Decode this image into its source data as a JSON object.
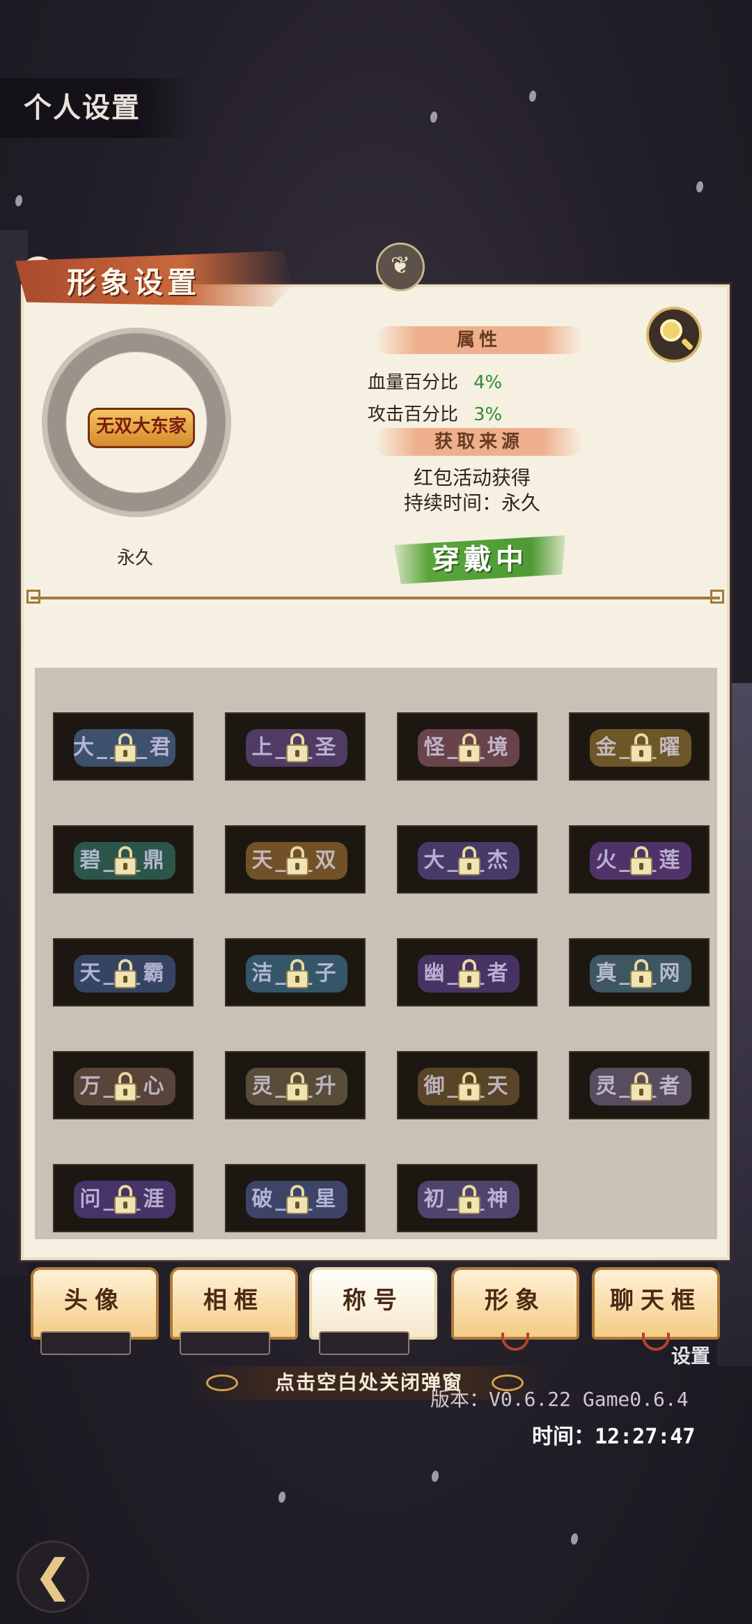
{
  "page": {
    "title": "个人设置",
    "settings_label": "设置",
    "close_hint": "点击空白处关闭弹窗",
    "version": "版本：V0.6.22 Game0.6.4",
    "time": "时间：12:27:47",
    "back_icon": "back-arrow-icon"
  },
  "panel": {
    "title": "形象设置",
    "equipped_badge": "无双大东家",
    "duration_under_avatar": "永久",
    "attributes_header": "属性",
    "attributes": [
      {
        "label": "血量百分比",
        "value": "4%"
      },
      {
        "label": "攻击百分比",
        "value": "3%"
      }
    ],
    "source_header": "获取来源",
    "source_text": "红包活动获得",
    "duration_text": "持续时间：永久",
    "wearing_label": "穿戴中",
    "colors": {
      "panel_bg": "#f6f0e2",
      "value_green": "#2e8d2e",
      "wearing_green": "#4e9a34"
    }
  },
  "titles": [
    {
      "name": "大____君",
      "color": "#5a7fb8",
      "locked": true
    },
    {
      "name": "上___圣",
      "color": "#7a5aa8",
      "locked": true
    },
    {
      "name": "怪___境",
      "color": "#a86a7a",
      "locked": true
    },
    {
      "name": "金___曜",
      "color": "#b08a3a",
      "locked": true
    },
    {
      "name": "碧___鼎",
      "color": "#3a8a7a",
      "locked": true
    },
    {
      "name": "天___双",
      "color": "#b8823a",
      "locked": true
    },
    {
      "name": "大___杰",
      "color": "#6a5ab0",
      "locked": true
    },
    {
      "name": "火___莲",
      "color": "#7a4ab0",
      "locked": true
    },
    {
      "name": "天___霸",
      "color": "#4a6aa8",
      "locked": true
    },
    {
      "name": "洁___子",
      "color": "#4a8ab0",
      "locked": true
    },
    {
      "name": "幽___者",
      "color": "#6a4aa8",
      "locked": true
    },
    {
      "name": "真___网",
      "color": "#5a8aa0",
      "locked": true
    },
    {
      "name": "万___心",
      "color": "#8a6a5a",
      "locked": true
    },
    {
      "name": "灵___升",
      "color": "#8a7a5a",
      "locked": true
    },
    {
      "name": "御___天",
      "color": "#8a6a3a",
      "locked": true
    },
    {
      "name": "灵___者",
      "color": "#8a7a9a",
      "locked": true
    },
    {
      "name": "问___涯",
      "color": "#6a4ab0",
      "locked": true
    },
    {
      "name": "破___星",
      "color": "#5a6ab0",
      "locked": true
    },
    {
      "name": "初___神",
      "color": "#7a6ab8",
      "locked": true
    }
  ],
  "tabs": [
    {
      "label": "头像",
      "active": false
    },
    {
      "label": "相框",
      "active": false
    },
    {
      "label": "称号",
      "active": true
    },
    {
      "label": "形象",
      "active": false
    },
    {
      "label": "聊天框",
      "active": false
    }
  ]
}
